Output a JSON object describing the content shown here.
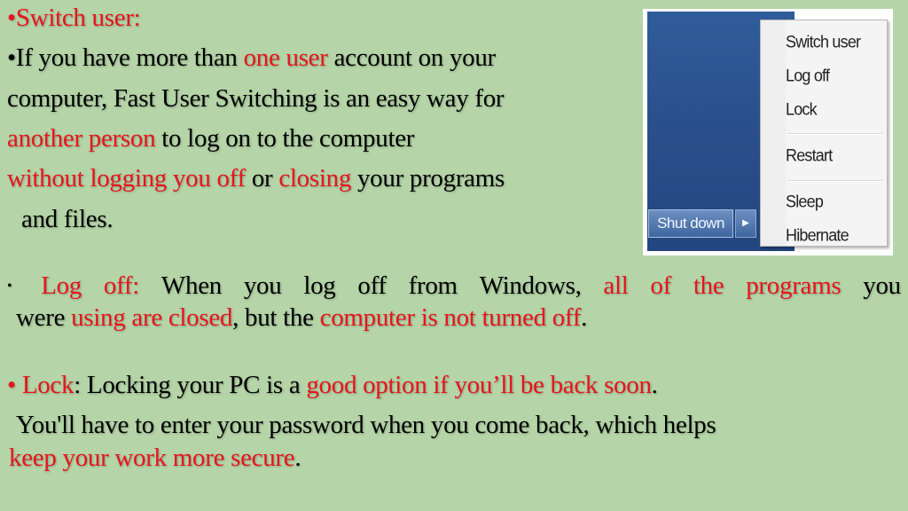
{
  "slide": {
    "switch_user": {
      "heading": "•Switch user:",
      "line1": {
        "a": "•If you have more than ",
        "b": "one user",
        "c": " account on your"
      },
      "line2": "computer, Fast User Switching is an easy way for",
      "line3": {
        "a": "another person",
        "b": " to log on to the computer"
      },
      "line4": {
        "a": "without logging you off",
        "b": " or ",
        "c": "closing",
        "d": " your programs"
      },
      "line5": "and files."
    },
    "log_off": {
      "bullet": "•",
      "words1": [
        "Log",
        "off:",
        "When",
        "you",
        "log",
        "off",
        "from",
        "Windows,",
        "all",
        "of",
        "the",
        "programs",
        "you"
      ],
      "line2": {
        "a": "were ",
        "b": "using are closed",
        "c": ", but the ",
        "d": "computer is not turned off",
        "e": "."
      }
    },
    "lock": {
      "line1": {
        "bullet": "• ",
        "a": "Lock",
        "b": ": Locking your PC is a ",
        "c": "good option if you’ll be back soon",
        "d": "."
      },
      "line2": "You'll have to enter your password when you come back, which helps",
      "line3": {
        "a": "keep your work more secure",
        "b": "."
      }
    }
  },
  "screenshot": {
    "menu_items": [
      "Switch user",
      "Log off",
      "Lock",
      "Restart",
      "Sleep",
      "Hibernate"
    ],
    "shutdown_label": "Shut down",
    "arrow_glyph": "▶"
  }
}
